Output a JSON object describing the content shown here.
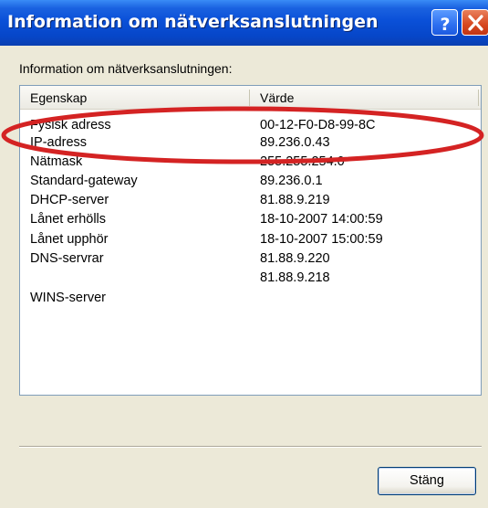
{
  "window": {
    "title": "Information om nätverksanslutningen",
    "help_icon": "help-icon",
    "close_icon": "close-icon"
  },
  "group_label": "Information om nätverksanslutningen:",
  "table": {
    "columns": [
      "Egenskap",
      "Värde"
    ],
    "rows": [
      {
        "property": "Fysisk adress",
        "value": "00-12-F0-D8-99-8C"
      },
      {
        "property": "IP-adress",
        "value": "89.236.0.43"
      },
      {
        "property": "Nätmask",
        "value": "255.255.254.0"
      },
      {
        "property": "Standard-gateway",
        "value": "89.236.0.1"
      },
      {
        "property": "DHCP-server",
        "value": "81.88.9.219"
      },
      {
        "property": "Lånet erhölls",
        "value": "18-10-2007 14:00:59"
      },
      {
        "property": "Lånet upphör",
        "value": "18-10-2007 15:00:59"
      },
      {
        "property": "DNS-servrar",
        "value": "81.88.9.220"
      },
      {
        "property": "",
        "value": "81.88.9.218"
      },
      {
        "property": "WINS-server",
        "value": ""
      }
    ]
  },
  "buttons": {
    "close_label": "Stäng"
  },
  "colors": {
    "titlebar": "#0a50d8",
    "dialog_bg": "#ece9d8",
    "highlight_ellipse": "#d42323"
  }
}
